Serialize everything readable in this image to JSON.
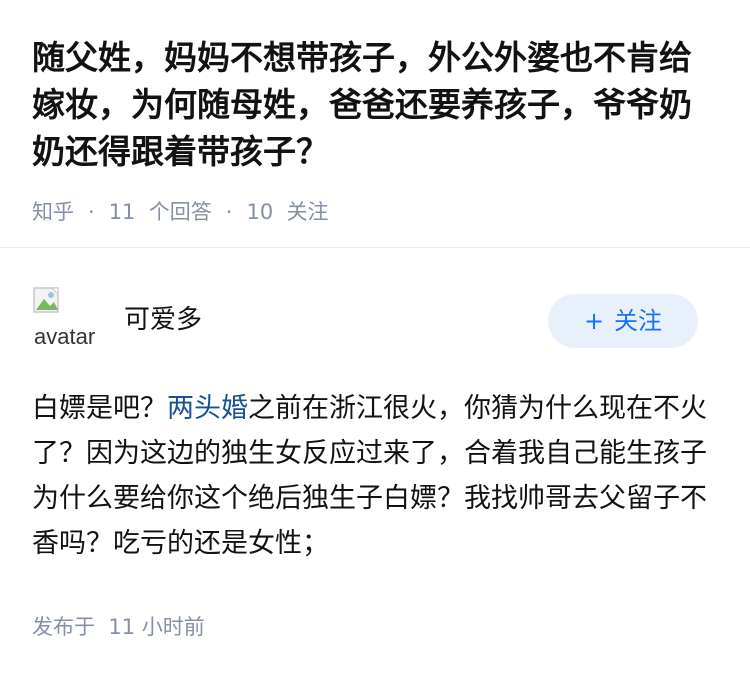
{
  "question": {
    "title": "随父姓，妈妈不想带孩子，外公外婆也不肯给嫁妆，为何随母姓，爸爸还要养孩子，爷爷奶奶还得跟着带孩子？",
    "source": "知乎",
    "answers_count": "11",
    "answers_label": "个回答",
    "followers_count": "10",
    "followers_label": "关注"
  },
  "answer": {
    "avatar_alt": "avatar",
    "author_name": "可爱多",
    "follow_plus": "+",
    "follow_label": "关注",
    "content_before": "白嫖是吧？",
    "content_link": "两头婚",
    "content_after": "之前在浙江很火，你猜为什么现在不火了？因为这边的独生女反应过来了，合着我自己能生孩子为什么要给你这个绝后独生子白嫖？我找帅哥去父留子不香吗？吃亏的还是女性；",
    "published_label": "发布于",
    "published_time": "11 小时前"
  },
  "colors": {
    "link": "#175199",
    "meta": "#8590a6",
    "follow_bg": "#e7f0fb",
    "follow_text": "#1772f6"
  }
}
